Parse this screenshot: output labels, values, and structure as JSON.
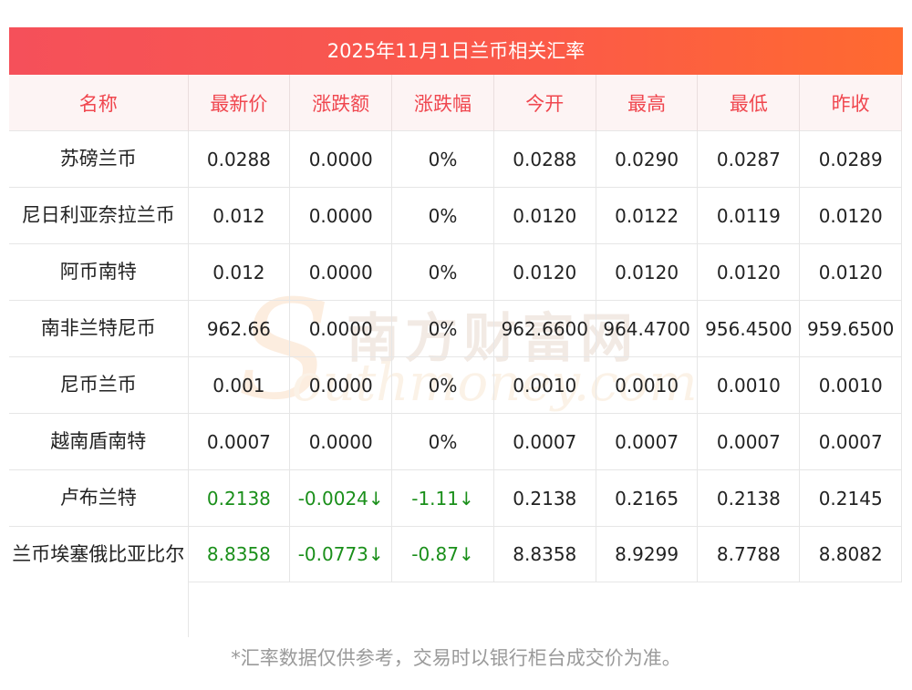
{
  "banner": {
    "title": "2025年11月1日兰币相关汇率"
  },
  "table": {
    "headers": [
      "名称",
      "最新价",
      "涨跌额",
      "涨跌幅",
      "今开",
      "最高",
      "最低",
      "昨收"
    ],
    "rows": [
      [
        "苏磅兰币",
        "0.0288",
        "0.0000",
        "0%",
        "0.0288",
        "0.0290",
        "0.0287",
        "0.0289"
      ],
      [
        "尼日利亚奈拉兰币",
        "0.012",
        "0.0000",
        "0%",
        "0.0120",
        "0.0122",
        "0.0119",
        "0.0120"
      ],
      [
        "阿币南特",
        "0.012",
        "0.0000",
        "0%",
        "0.0120",
        "0.0120",
        "0.0120",
        "0.0120"
      ],
      [
        "南非兰特尼币",
        "962.66",
        "0.0000",
        "0%",
        "962.6600",
        "964.4700",
        "956.4500",
        "959.6500"
      ],
      [
        "尼币兰币",
        "0.001",
        "0.0000",
        "0%",
        "0.0010",
        "0.0010",
        "0.0010",
        "0.0010"
      ],
      [
        "越南盾南特",
        "0.0007",
        "0.0000",
        "0%",
        "0.0007",
        "0.0007",
        "0.0007",
        "0.0007"
      ],
      [
        "卢布兰特",
        "0.2138",
        "-0.0024↓",
        "-1.11↓",
        "0.2138",
        "0.2165",
        "0.2138",
        "0.2145"
      ],
      [
        "兰币埃塞俄比亚比尔",
        "8.8358",
        "-0.0773↓",
        "-0.87↓",
        "8.8358",
        "8.9299",
        "8.7788",
        "8.8082"
      ]
    ]
  },
  "watermark": {
    "cn": "南方财富网",
    "en": "outhmoney.com",
    "s": "S"
  },
  "footer": {
    "note": "*汇率数据仅供参考，交易时以银行柜台成交价为准。"
  },
  "colors": {
    "header_text": "#f0474f",
    "down": "#1a8f1a",
    "banner_start": "#f5505a",
    "banner_end": "#ff6a30"
  }
}
